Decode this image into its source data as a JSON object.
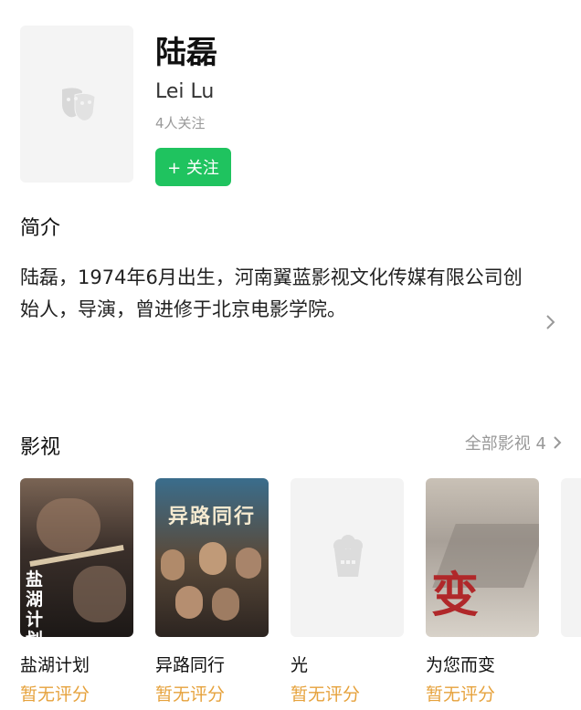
{
  "profile": {
    "name": "陆磊",
    "en_name": "Lei Lu",
    "followers": "4人关注",
    "follow_label": "+ 关注"
  },
  "intro": {
    "title": "简介",
    "text": "陆磊，1974年6月出生，河南翼蓝影视文化传媒有限公司创始人，导演，曾进修于北京电影学院。"
  },
  "works": {
    "title": "影视",
    "all_label": "全部影视 4",
    "items": [
      {
        "title": "盐湖计划",
        "rating": "暂无评分",
        "poster_text": "盐湖计划"
      },
      {
        "title": "异路同行",
        "rating": "暂无评分",
        "poster_text": "异路同行"
      },
      {
        "title": "光",
        "rating": "暂无评分",
        "poster_text": ""
      },
      {
        "title": "为您而变",
        "rating": "暂无评分",
        "poster_text": "变"
      }
    ]
  },
  "colors": {
    "accent": "#1fc35f",
    "rating": "#e6a23c"
  }
}
